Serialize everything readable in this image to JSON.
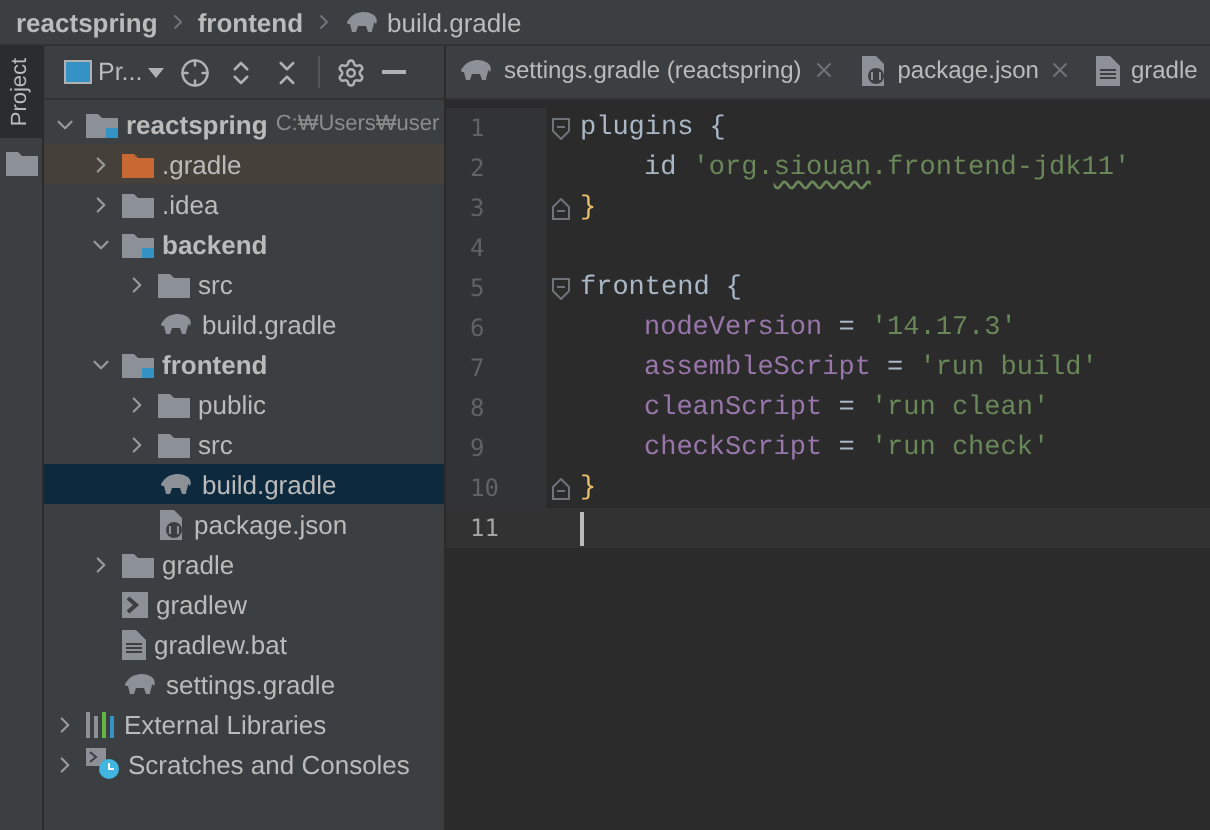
{
  "breadcrumbs": [
    {
      "label": "reactspring",
      "kind": "folder"
    },
    {
      "label": "frontend",
      "kind": "folder"
    },
    {
      "label": "build.gradle",
      "kind": "gradle"
    }
  ],
  "side_tabs": [
    {
      "label": "Project",
      "selected": true
    }
  ],
  "project_panel": {
    "view_label": "Pr...",
    "tree": [
      {
        "label": "reactspring",
        "note": "C:₩Users₩user",
        "kind": "module",
        "expanded": true,
        "selected": false,
        "children": [
          {
            "label": ".gradle",
            "kind": "excluded",
            "expanded": false,
            "selected": false
          },
          {
            "label": ".idea",
            "kind": "folder",
            "expanded": false,
            "selected": false
          },
          {
            "label": "backend",
            "kind": "module",
            "expanded": true,
            "selected": false,
            "children": [
              {
                "label": "src",
                "kind": "folder",
                "expanded": false,
                "selected": false
              },
              {
                "label": "build.gradle",
                "kind": "gradle",
                "selected": false
              }
            ]
          },
          {
            "label": "frontend",
            "kind": "module",
            "expanded": true,
            "selected": false,
            "children": [
              {
                "label": "public",
                "kind": "folder",
                "expanded": false,
                "selected": false
              },
              {
                "label": "src",
                "kind": "folder",
                "expanded": false,
                "selected": false
              },
              {
                "label": "build.gradle",
                "kind": "gradle",
                "selected": true
              },
              {
                "label": "package.json",
                "kind": "json",
                "selected": false
              }
            ]
          },
          {
            "label": "gradle",
            "kind": "folder",
            "expanded": false,
            "selected": false
          },
          {
            "label": "gradlew",
            "kind": "script",
            "selected": false
          },
          {
            "label": "gradlew.bat",
            "kind": "file",
            "selected": false
          },
          {
            "label": "settings.gradle",
            "kind": "gradle",
            "selected": false
          }
        ]
      },
      {
        "label": "External Libraries",
        "kind": "libraries",
        "expanded": false,
        "selected": false
      },
      {
        "label": "Scratches and Consoles",
        "kind": "scratches",
        "expanded": false,
        "selected": false
      }
    ]
  },
  "editor_tabs": [
    {
      "label": "settings.gradle (reactspring)",
      "kind": "gradle",
      "selected": false,
      "closable": true
    },
    {
      "label": "package.json",
      "kind": "json",
      "selected": false,
      "closable": true
    },
    {
      "label": "gradle",
      "kind": "file",
      "selected": false,
      "closable": false
    }
  ],
  "code_lines": [
    {
      "number": "1",
      "fold_start": true,
      "current": false,
      "tokens": [
        {
          "text": "plugins {",
          "kind": "plain"
        }
      ]
    },
    {
      "number": "2",
      "indent": true,
      "current": false,
      "tokens": [
        {
          "text": "id ",
          "kind": "plain"
        },
        {
          "text": "'org.",
          "kind": "string"
        },
        {
          "text": "siouan",
          "kind": "typo"
        },
        {
          "text": ".frontend-jdk11'",
          "kind": "string"
        }
      ]
    },
    {
      "number": "3",
      "fold_end": true,
      "current": false,
      "tokens": [
        {
          "text": "}",
          "kind": "brace"
        }
      ]
    },
    {
      "number": "4",
      "current": false
    },
    {
      "number": "5",
      "fold_start": true,
      "current": false,
      "tokens": [
        {
          "text": "frontend {",
          "kind": "plain"
        }
      ]
    },
    {
      "number": "6",
      "indent": true,
      "current": false,
      "tokens": [
        {
          "text": "nodeVersion",
          "kind": "property"
        },
        {
          "text": " = ",
          "kind": "plain"
        },
        {
          "text": "'14.17.3'",
          "kind": "string"
        }
      ]
    },
    {
      "number": "7",
      "indent": true,
      "current": false,
      "tokens": [
        {
          "text": "assembleScript",
          "kind": "property"
        },
        {
          "text": " = ",
          "kind": "plain"
        },
        {
          "text": "'run build'",
          "kind": "string"
        }
      ]
    },
    {
      "number": "8",
      "indent": true,
      "current": false,
      "tokens": [
        {
          "text": "cleanScript",
          "kind": "property"
        },
        {
          "text": " = ",
          "kind": "plain"
        },
        {
          "text": "'run clean'",
          "kind": "string"
        }
      ]
    },
    {
      "number": "9",
      "indent": true,
      "current": false,
      "tokens": [
        {
          "text": "checkScript",
          "kind": "property"
        },
        {
          "text": " = ",
          "kind": "plain"
        },
        {
          "text": "'run check'",
          "kind": "string"
        }
      ]
    },
    {
      "number": "10",
      "fold_end": true,
      "current": false,
      "tokens": [
        {
          "text": "}",
          "kind": "brace"
        }
      ]
    },
    {
      "number": "11",
      "current": true
    }
  ]
}
